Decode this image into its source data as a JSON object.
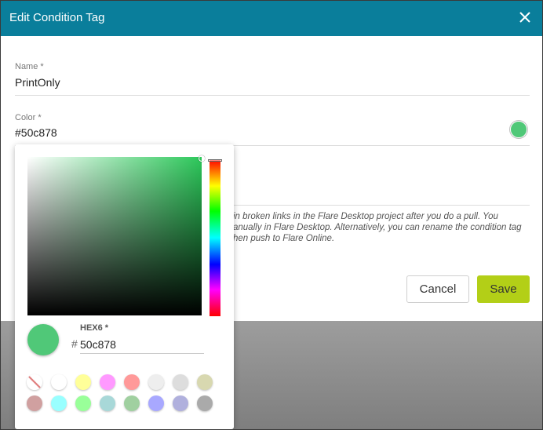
{
  "dialog": {
    "title": "Edit Condition Tag",
    "name_label": "Name *",
    "name_value": "PrintOnly",
    "color_label": "Color *",
    "color_value": "#50c878",
    "warning_text": "in broken links in the Flare Desktop project after you do a pull. You\nanually in Flare Desktop. Alternatively, you can rename the condition tag\nhen push to Flare Online.",
    "cancel_label": "Cancel",
    "save_label": "Save"
  },
  "picker": {
    "hex_label": "HEX6 *",
    "hash": "#",
    "hex_value": "50c878",
    "presets": [
      "none",
      "#ffffff",
      "#ffff99",
      "#ff99ff",
      "#ff9999",
      "#eeeeee",
      "#dddddd",
      "#d8d8b0",
      "#d0a0a0",
      "#99ffff",
      "#99ff99",
      "#a8d8d8",
      "#a0d0a0",
      "#a8a8ff",
      "#b0b0dd",
      "#aaaaaa"
    ]
  },
  "colors": {
    "header": "#0a7e9b",
    "selected": "#50c878",
    "save_button": "#b3cf17"
  },
  "icons": {
    "close": "close-icon"
  }
}
